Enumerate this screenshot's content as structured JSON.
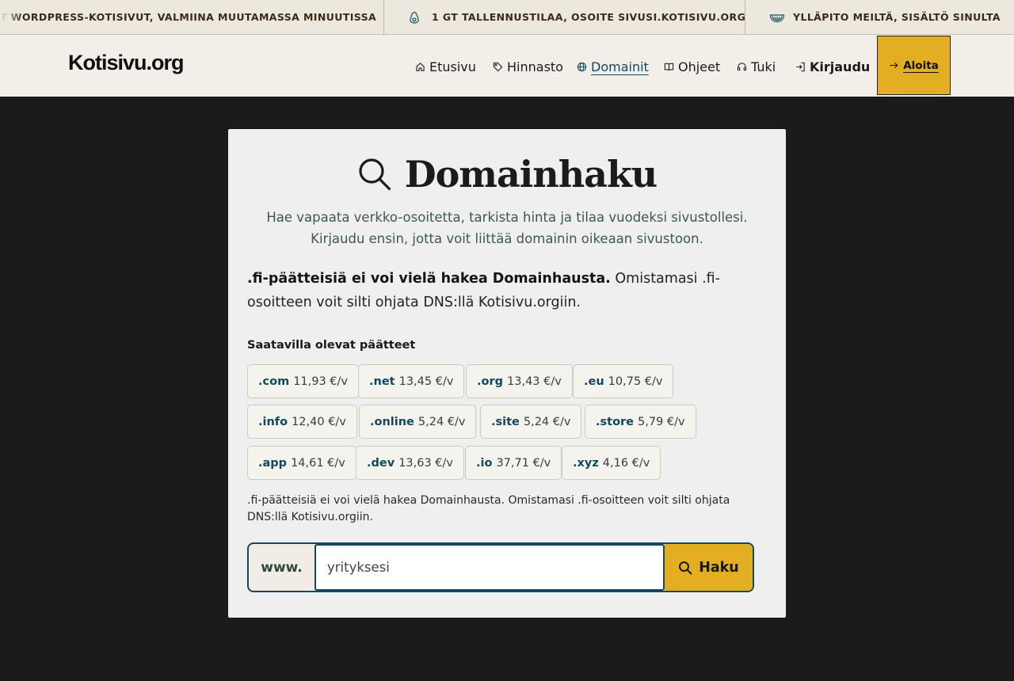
{
  "ticker": {
    "items": [
      "T WORDPRESS-KOTISIVUT, VALMIINA MUUTAMASSA MINUUTISSA",
      "1 GT TALLENNUSTILAA, OSOITE SIVUSI.KOTISIVU.ORG",
      "YLLÄPITO MEILTÄ, SISÄLTÖ SINULTA"
    ],
    "icons": [
      "",
      "avocado-icon",
      "fruit-slice-icon"
    ]
  },
  "header": {
    "logo": "Kotisivu.org",
    "nav": [
      {
        "label": "Etusivu",
        "icon": "home-icon"
      },
      {
        "label": "Hinnasto",
        "icon": "tag-icon"
      },
      {
        "label": "Domainit",
        "icon": "globe-icon",
        "active": true
      },
      {
        "label": "Ohjeet",
        "icon": "book-icon"
      },
      {
        "label": "Tuki",
        "icon": "headset-icon"
      },
      {
        "label": "Kirjaudu",
        "icon": "login-icon"
      }
    ],
    "cta": {
      "label": "Aloita",
      "icon": "arrow-right-icon"
    }
  },
  "main": {
    "title": "Domainhaku",
    "subtitle_line1": "Hae vapaata verkko-osoitetta, tarkista hinta ja tilaa vuodeksi sivustollesi.",
    "subtitle_line2": "Kirjaudu ensin, jotta voit liittää domainin oikeaan sivustoon.",
    "notice_bold": ".fi-päätteisiä ei voi vielä hakea Domainhausta.",
    "notice_rest": " Omistamasi .fi-osoitteen voit silti ohjata DNS:llä Kotisivu.orgiin.",
    "tld_heading": "Saatavilla olevat päätteet",
    "tlds": [
      {
        "ext": ".com",
        "price": "11,93 €/v"
      },
      {
        "ext": ".net",
        "price": "13,45 €/v"
      },
      {
        "ext": ".org",
        "price": "13,43 €/v"
      },
      {
        "ext": ".eu",
        "price": "10,75 €/v"
      },
      {
        "ext": ".info",
        "price": "12,40 €/v"
      },
      {
        "ext": ".online",
        "price": "5,24 €/v"
      },
      {
        "ext": ".site",
        "price": "5,24 €/v"
      },
      {
        "ext": ".store",
        "price": "5,79 €/v"
      },
      {
        "ext": ".app",
        "price": "14,61 €/v"
      },
      {
        "ext": ".dev",
        "price": "13,63 €/v"
      },
      {
        "ext": ".io",
        "price": "37,71 €/v"
      },
      {
        "ext": ".xyz",
        "price": "4,16 €/v"
      }
    ],
    "note": ".fi-päätteisiä ei voi vielä hakea Domainhausta. Omistamasi .fi-osoitteen voit silti ohjata DNS:llä Kotisivu.orgiin.",
    "search": {
      "prefix": "www.",
      "placeholder": "yrityksesi",
      "value": "",
      "button": "Haku"
    }
  },
  "colors": {
    "accent": "#e4ae22",
    "link": "#0f4a5e",
    "background": "#1b1b1b",
    "card": "#efefef"
  }
}
